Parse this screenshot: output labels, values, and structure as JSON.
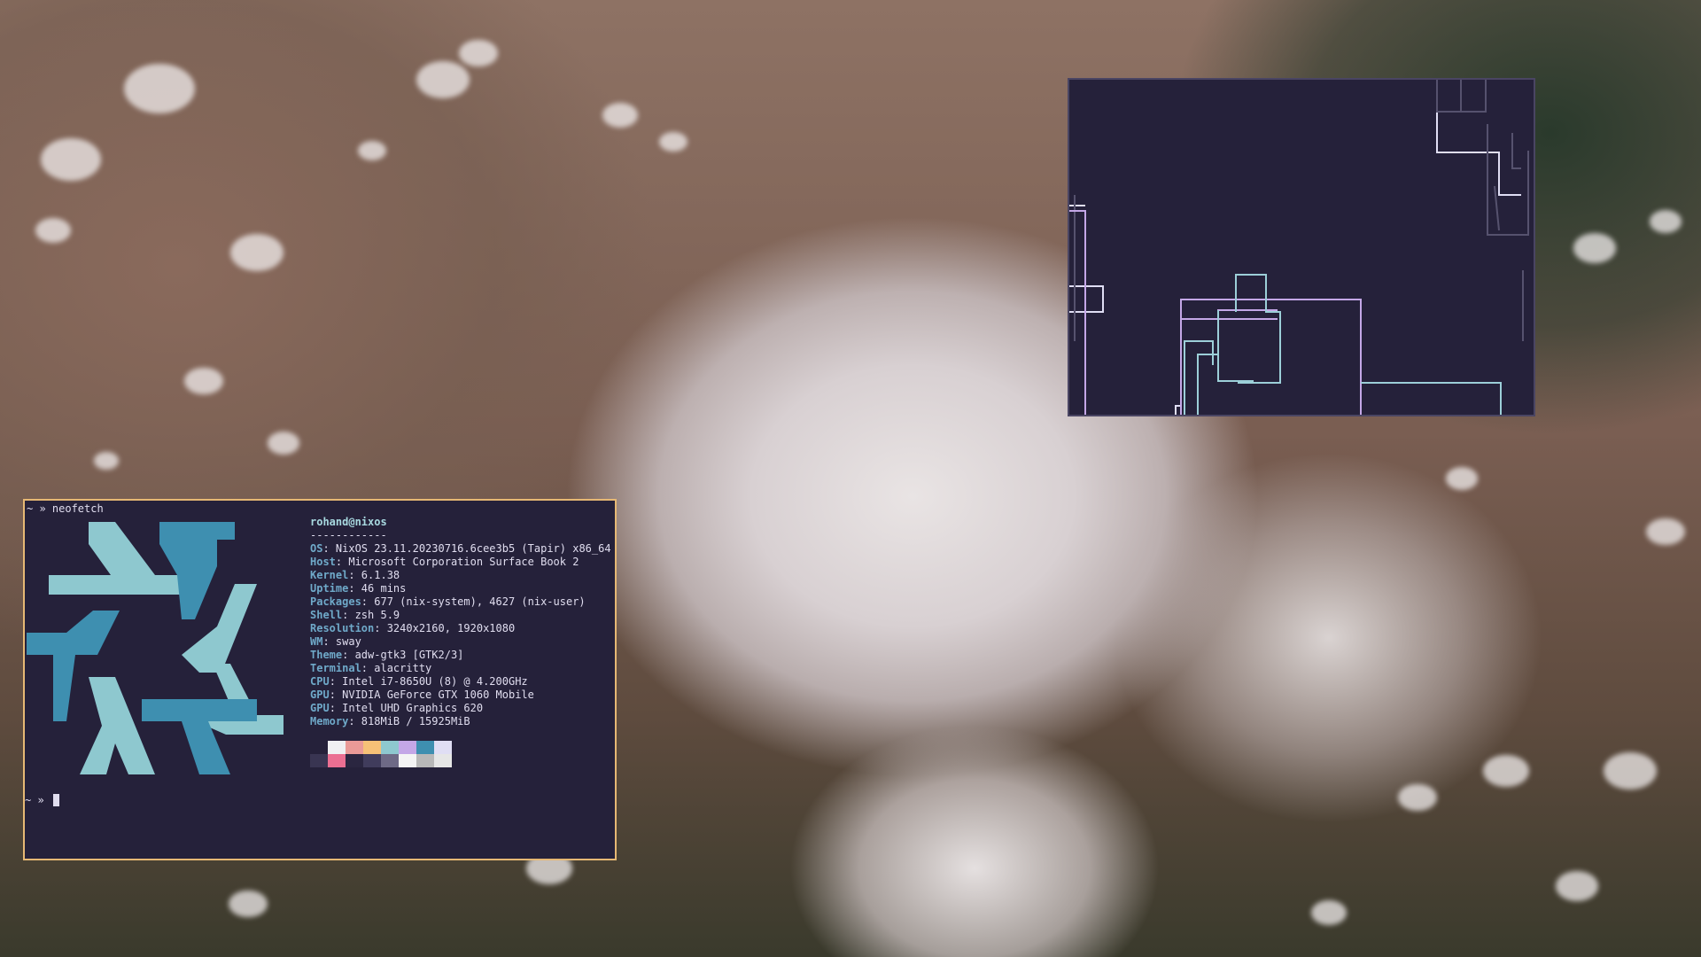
{
  "terminal": {
    "prompt1": "~ » neofetch",
    "user_host": "rohand@nixos",
    "separator": "------------",
    "info": [
      {
        "label": "OS",
        "value": ": NixOS 23.11.20230716.6cee3b5 (Tapir) x86_64"
      },
      {
        "label": "Host",
        "value": ": Microsoft Corporation Surface Book 2"
      },
      {
        "label": "Kernel",
        "value": ": 6.1.38"
      },
      {
        "label": "Uptime",
        "value": ": 46 mins"
      },
      {
        "label": "Packages",
        "value": ": 677 (nix-system), 4627 (nix-user)"
      },
      {
        "label": "Shell",
        "value": ": zsh 5.9"
      },
      {
        "label": "Resolution",
        "value": ": 3240x2160, 1920x1080"
      },
      {
        "label": "WM",
        "value": ": sway"
      },
      {
        "label": "Theme",
        "value": ": adw-gtk3 [GTK2/3]"
      },
      {
        "label": "Terminal",
        "value": ": alacritty"
      },
      {
        "label": "CPU",
        "value": ": Intel i7-8650U (8) @ 4.200GHz"
      },
      {
        "label": "GPU",
        "value": ": NVIDIA GeForce GTX 1060 Mobile"
      },
      {
        "label": "GPU",
        "value": ": Intel UHD Graphics 620"
      },
      {
        "label": "Memory",
        "value": ": 818MiB / 15925MiB"
      }
    ],
    "palette_top": [
      "#25213a",
      "#f0f0f2",
      "#ea9a97",
      "#f6c177",
      "#8ec8cf",
      "#c4a7e7",
      "#3e8fb0",
      "#e0def4"
    ],
    "palette_bottom": [
      "#393552",
      "#eb6f92",
      "#2a2640",
      "#403c5c",
      "#6e6a86",
      "#f4f4f4",
      "#b8b8b8",
      "#e6e6e6"
    ],
    "prompt2": "~ »",
    "logo_colors": {
      "light": "#8ec8cf",
      "dark": "#3e8fb0"
    }
  },
  "visualizer": {
    "colors": {
      "light": "#e0def4",
      "teal": "#9ccfd8",
      "purple": "#c4a7e7",
      "dim": "#56526e"
    }
  }
}
